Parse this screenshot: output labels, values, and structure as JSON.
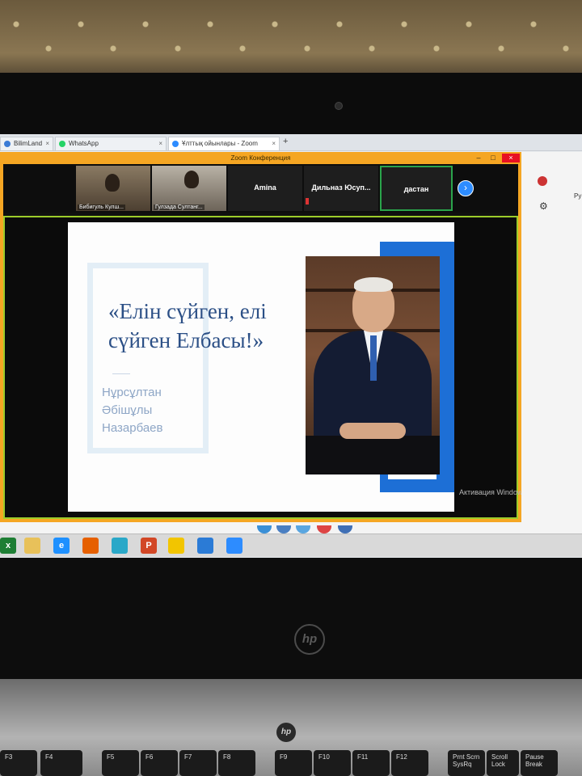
{
  "browser": {
    "tabs": [
      {
        "label": "BilimLand"
      },
      {
        "label": "WhatsApp"
      },
      {
        "label": "Ұлттық ойынлары - Zoom"
      }
    ],
    "new_tab": "+"
  },
  "zoom": {
    "window_title": "Zoom Конференция",
    "participants": [
      {
        "name": "Бибигуль Кулш..."
      },
      {
        "name": "Гулзада Султанг..."
      },
      {
        "name": "Amina"
      },
      {
        "name": "Дильназ Юсуп..."
      },
      {
        "name": "дастан"
      }
    ],
    "next_button": "›",
    "activation_text": "Активация Windows"
  },
  "slide": {
    "title": "«Елін сүйген, елі сүйген Елбасы!»",
    "name_lines": [
      "Нұрсұлтан",
      "Әбішұлы",
      "Назарбаев"
    ]
  },
  "chrome_right": {
    "text": "Ру"
  },
  "keyboard": {
    "keys": [
      "F3",
      "F4",
      "F5",
      "F6",
      "F7",
      "F8",
      "F9",
      "F10",
      "F11",
      "F12",
      "Prnt Scrn SysRq",
      "Scroll Lock",
      "Pause Break"
    ]
  },
  "laptop": {
    "brand": "hp"
  },
  "colors": {
    "zoom_border": "#f5a623",
    "active_speaker": "#9ccc2a",
    "slide_title": "#2b4f86",
    "slide_accent": "#1d6fd6"
  }
}
